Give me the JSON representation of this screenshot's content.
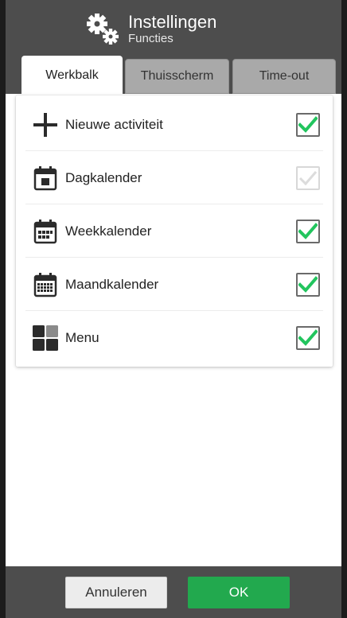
{
  "header": {
    "title": "Instellingen",
    "subtitle": "Functies",
    "icon": "gears-icon"
  },
  "tabs": [
    {
      "label": "Werkbalk",
      "active": true
    },
    {
      "label": "Thuisscherm",
      "active": false
    },
    {
      "label": "Time-out",
      "active": false
    }
  ],
  "items": [
    {
      "label": "Nieuwe activiteit",
      "icon": "plus-icon",
      "checked": true,
      "enabled": true
    },
    {
      "label": "Dagkalender",
      "icon": "day-calendar-icon",
      "checked": true,
      "enabled": false
    },
    {
      "label": "Weekkalender",
      "icon": "week-calendar-icon",
      "checked": true,
      "enabled": true
    },
    {
      "label": "Maandkalender",
      "icon": "month-calendar-icon",
      "checked": true,
      "enabled": true
    },
    {
      "label": "Menu",
      "icon": "menu-grid-icon",
      "checked": true,
      "enabled": true
    }
  ],
  "footer": {
    "cancel_label": "Annuleren",
    "ok_label": "OK"
  },
  "colors": {
    "header_bg": "#4d4d4d",
    "check_green": "#22c55e",
    "ok_button": "#22a94e"
  }
}
